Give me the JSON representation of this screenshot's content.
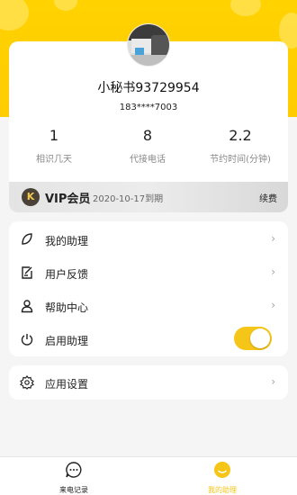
{
  "profile": {
    "name": "小秘书93729954",
    "phone": "183****7003"
  },
  "stats": [
    {
      "value": "1",
      "label": "相识几天"
    },
    {
      "value": "8",
      "label": "代接电话"
    },
    {
      "value": "2.2",
      "label": "节约时间(分钟)"
    }
  ],
  "vip": {
    "icon_glyph": "K",
    "title": "VIP会员",
    "expire": "2020-10-17到期",
    "renew": "续费"
  },
  "menu": {
    "items": [
      {
        "label": "我的助理",
        "icon": "leaf-icon"
      },
      {
        "label": "用户反馈",
        "icon": "feedback-icon"
      },
      {
        "label": "帮助中心",
        "icon": "person-icon"
      },
      {
        "label": "启用助理",
        "icon": "power-icon",
        "toggle_on": true
      }
    ],
    "settings": {
      "label": "应用设置",
      "icon": "gear-icon"
    }
  },
  "tabbar": {
    "tabs": [
      {
        "label": "来电记录",
        "icon": "chat-icon",
        "active": false
      },
      {
        "label": "我的助理",
        "icon": "smile-icon",
        "active": true
      }
    ]
  },
  "colors": {
    "accent": "#ffcc00",
    "toggle": "#f5c518",
    "vip_icon_bg": "#4a4236"
  }
}
